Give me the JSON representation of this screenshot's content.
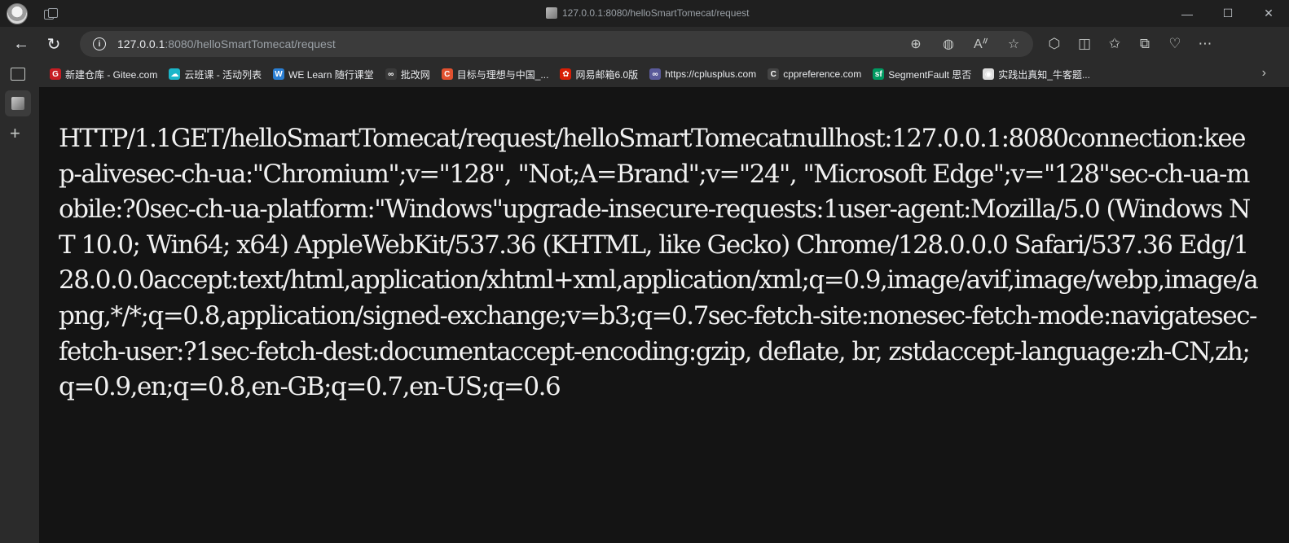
{
  "window": {
    "title": "127.0.0.1:8080/helloSmartTomecat/request",
    "controls": {
      "minimize": "—",
      "maximize": "☐",
      "close": "✕"
    }
  },
  "toolbar": {
    "url_host": "127.0.0.1",
    "url_path": ":8080/helloSmartTomecat/request"
  },
  "bookmarks": [
    {
      "label": "新建仓库 - Gitee.com",
      "icon": "gitee-icon",
      "color": "#c71d23",
      "glyph": "G"
    },
    {
      "label": "云班课 - 活动列表",
      "icon": "cloud-class-icon",
      "color": "#1bb6c9",
      "glyph": "☁"
    },
    {
      "label": "WE Learn 随行课堂",
      "icon": "welearn-icon",
      "color": "#2a7fd4",
      "glyph": "W"
    },
    {
      "label": "批改网",
      "icon": "pigai-icon",
      "color": "#3a3a3a",
      "glyph": "∞"
    },
    {
      "label": "目标与理想与中国_...",
      "icon": "course-icon",
      "color": "#e2512f",
      "glyph": "C"
    },
    {
      "label": "网易邮箱6.0版",
      "icon": "netease-mail-icon",
      "color": "#d81e06",
      "glyph": "✿"
    },
    {
      "label": "https://cplusplus.com",
      "icon": "cplusplus-icon",
      "color": "#5a5a9a",
      "glyph": "∞"
    },
    {
      "label": "cppreference.com",
      "icon": "cppreference-icon",
      "color": "#444444",
      "glyph": "C"
    },
    {
      "label": "SegmentFault 思否",
      "icon": "segmentfault-icon",
      "color": "#009a61",
      "glyph": "sf"
    },
    {
      "label": "实践出真知_牛客题...",
      "icon": "nowcoder-icon",
      "color": "#dddddd",
      "glyph": "◉"
    }
  ],
  "content": {
    "text": "HTTP/1.1GET/helloSmartTomecat/request/helloSmartTomecatnullhost:127.0.0.1:8080connection:keep-alivesec-ch-ua:\"Chromium\";v=\"128\", \"Not;A=Brand\";v=\"24\", \"Microsoft Edge\";v=\"128\"sec-ch-ua-mobile:?0sec-ch-ua-platform:\"Windows\"upgrade-insecure-requests:1user-agent:Mozilla/5.0 (Windows NT 10.0; Win64; x64) AppleWebKit/537.36 (KHTML, like Gecko) Chrome/128.0.0.0 Safari/537.36 Edg/128.0.0.0accept:text/html,application/xhtml+xml,application/xml;q=0.9,image/avif,image/webp,image/apng,*/*;q=0.8,application/signed-exchange;v=b3;q=0.7sec-fetch-site:nonesec-fetch-mode:navigatesec-fetch-user:?1sec-fetch-dest:documentaccept-encoding:gzip, deflate, br, zstdaccept-language:zh-CN,zh;q=0.9,en;q=0.8,en-GB;q=0.7,en-US;q=0.6"
  }
}
